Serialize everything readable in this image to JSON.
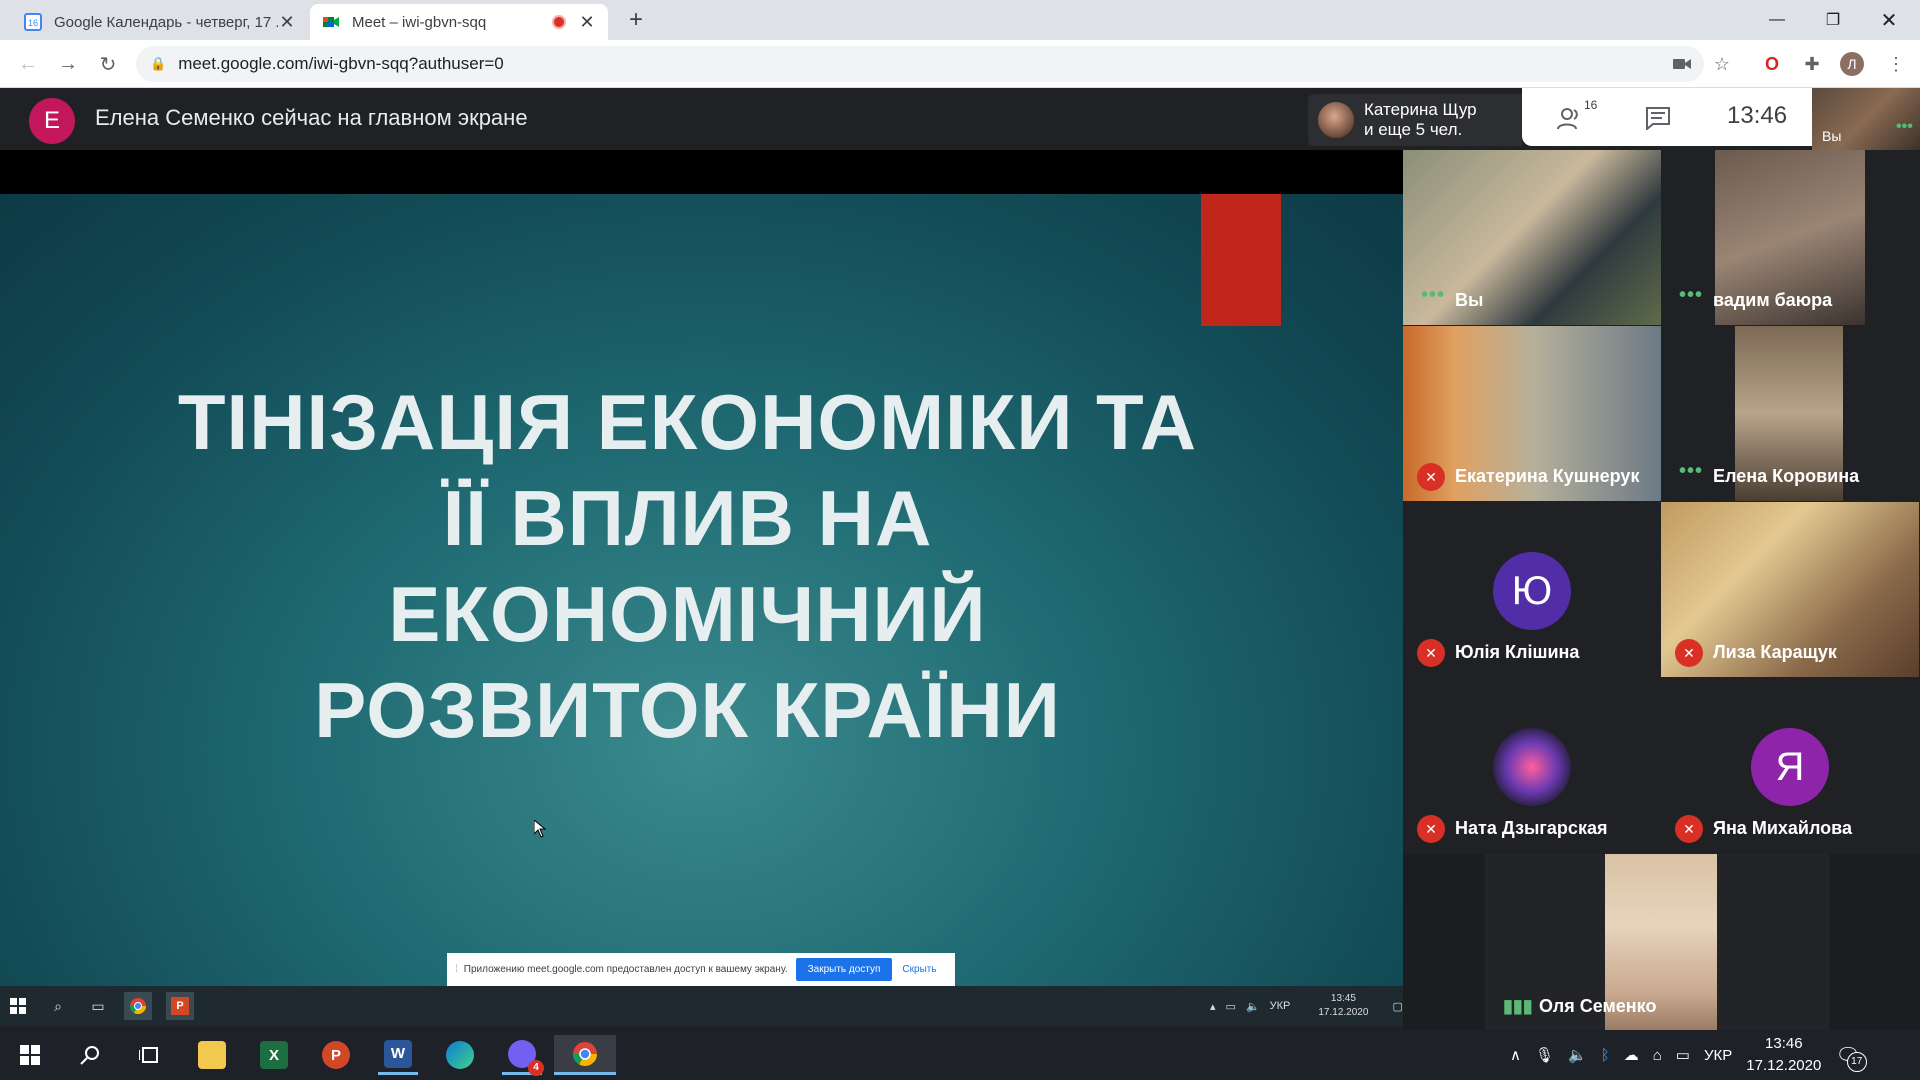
{
  "browser": {
    "tabs": [
      {
        "title": "Google Календарь - четверг, 17 ...",
        "favicon": "calendar-icon",
        "favicon_text": "16"
      },
      {
        "title": "Meet – iwi-gbvn-sqq",
        "favicon": "meet-icon"
      }
    ],
    "url": "meet.google.com/iwi-gbvn-sqq?authuser=0",
    "profile_initial": "Л"
  },
  "meet": {
    "presenter_initial": "E",
    "presenter_banner": "Елена Семенко сейчас на главном экране",
    "joiner_text_line1": "Катерина Щур",
    "joiner_text_line2": "и еще 5 чел.",
    "participant_count": "16",
    "clock": "13:46",
    "self_label": "Вы"
  },
  "slide": {
    "title_lines": [
      "ТІНІЗАЦІЯ ЕКОНОМІКИ ТА",
      "ЇЇ ВПЛИВ НА",
      "ЕКОНОМІЧНИЙ",
      "РОЗВИТОК КРАЇНИ"
    ],
    "accent_color": "#c0261a"
  },
  "share_bar": {
    "message": "Приложению meet.google.com предоставлен доступ к вашему экрану.",
    "stop_label": "Закрыть доступ",
    "hide_label": "Скрыть"
  },
  "inner_taskbar": {
    "lang": "УКР",
    "time": "13:45",
    "date": "17.12.2020"
  },
  "participants": [
    {
      "name": "Вы",
      "status": "speaking-dots"
    },
    {
      "name": "вадим баюра",
      "status": "speaking-dots"
    },
    {
      "name": "Екатерина Кушнерук",
      "status": "muted"
    },
    {
      "name": "Елена Коровина",
      "status": "speaking-dots"
    },
    {
      "name": "Юлія Клішина",
      "status": "muted",
      "initial": "Ю",
      "color": "#512da8"
    },
    {
      "name": "Лиза Каращук",
      "status": "muted"
    },
    {
      "name": "Ната Дзыгарская",
      "status": "muted"
    },
    {
      "name": "Яна Михайлова",
      "status": "muted",
      "initial": "Я",
      "color": "#8e24aa"
    },
    {
      "name": "Оля Семенко",
      "status": "speaking"
    }
  ],
  "taskbar": {
    "lang": "УКР",
    "time": "13:46",
    "date": "17.12.2020",
    "notifications": "17",
    "viber_badge": "4"
  }
}
